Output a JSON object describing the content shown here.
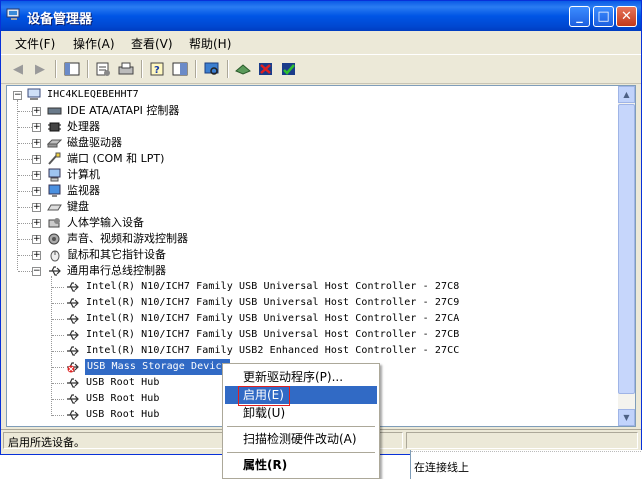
{
  "window": {
    "title": "设备管理器",
    "buttons": {
      "minimize": "_",
      "maximize": "□",
      "close": "✕"
    }
  },
  "menu": [
    "文件(F)",
    "操作(A)",
    "查看(V)",
    "帮助(H)"
  ],
  "toolbar": {
    "icons": [
      "back-arrow-icon",
      "forward-arrow-icon",
      "show-hide-tree-icon",
      "properties-icon",
      "print-icon",
      "help-icon",
      "console-tree-icon",
      "scan-hardware-icon",
      "update-driver-icon",
      "uninstall-icon",
      "enable-icon"
    ]
  },
  "tree": {
    "root": "IHC4KLEQEBEHHT7",
    "categories": [
      {
        "label": "IDE ATA/ATAPI 控制器",
        "icon": "ide-controller-icon",
        "expanded": false
      },
      {
        "label": "处理器",
        "icon": "processor-icon",
        "expanded": false
      },
      {
        "label": "磁盘驱动器",
        "icon": "disk-drive-icon",
        "expanded": false
      },
      {
        "label": "端口 (COM 和 LPT)",
        "icon": "port-icon",
        "expanded": false
      },
      {
        "label": "计算机",
        "icon": "computer-icon",
        "expanded": false
      },
      {
        "label": "监视器",
        "icon": "monitor-icon",
        "expanded": false
      },
      {
        "label": "键盘",
        "icon": "keyboard-icon",
        "expanded": false
      },
      {
        "label": "人体学输入设备",
        "icon": "hid-icon",
        "expanded": false
      },
      {
        "label": "声音、视频和游戏控制器",
        "icon": "sound-icon",
        "expanded": false
      },
      {
        "label": "鼠标和其它指针设备",
        "icon": "mouse-icon",
        "expanded": false
      },
      {
        "label": "通用串行总线控制器",
        "icon": "usb-icon",
        "expanded": true
      }
    ],
    "usb_devices": [
      "Intel(R) N10/ICH7 Family USB Universal Host Controller - 27C8",
      "Intel(R) N10/ICH7 Family USB Universal Host Controller - 27C9",
      "Intel(R) N10/ICH7 Family USB Universal Host Controller - 27CA",
      "Intel(R) N10/ICH7 Family USB Universal Host Controller - 27CB",
      "Intel(R) N10/ICH7 Family USB2 Enhanced Host Controller - 27CC",
      "USB Mass Storage Device",
      "USB Root Hub",
      "USB Root Hub",
      "USB Root Hub"
    ],
    "selected_device": "USB Mass Storage Device"
  },
  "context_menu": {
    "items": [
      "更新驱动程序(P)...",
      "启用(E)",
      "卸载(U)",
      "扫描检测硬件改动(A)",
      "属性(R)"
    ],
    "highlighted": "启用(E)"
  },
  "status": {
    "text": "启用所选设备。"
  },
  "background_window": {
    "line1": "在连接线上"
  },
  "colors": {
    "titlebar": "#0055e5",
    "selection": "#316ac5",
    "highlight_box": "#e02020"
  }
}
